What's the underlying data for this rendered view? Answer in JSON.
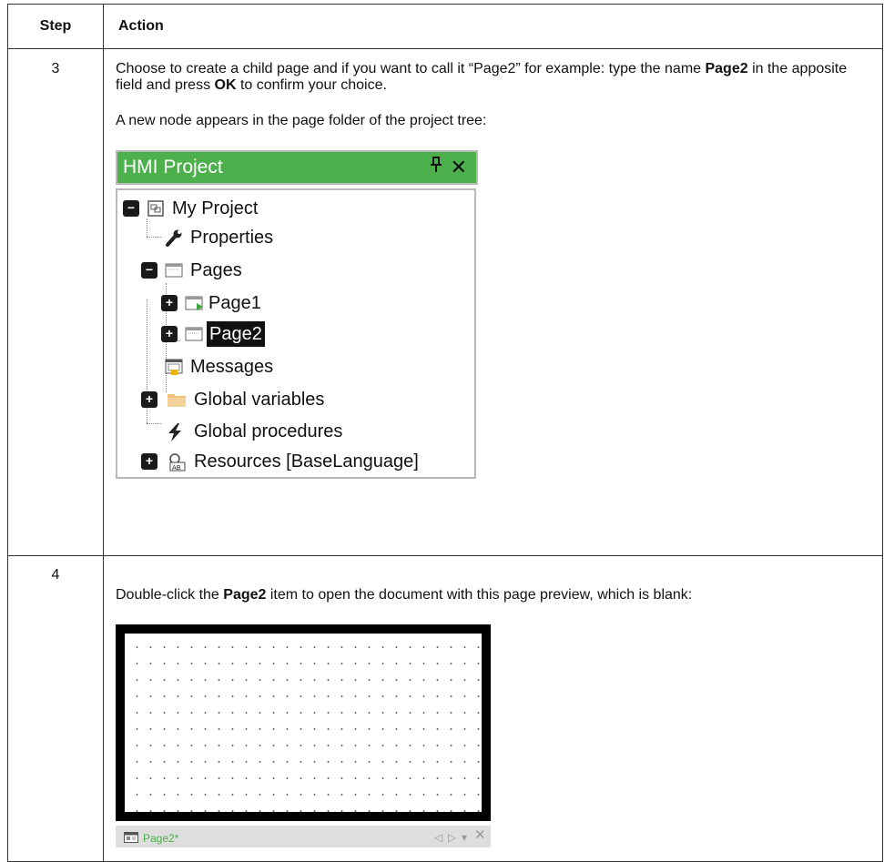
{
  "table": {
    "headers": {
      "step": "Step",
      "action": "Action"
    },
    "rows": [
      {
        "step": "3",
        "para1_pre": "Choose to create a child page and if you want to call it “Page2” for example: type the name ",
        "para1_bold1": "Page2",
        "para1_mid": " in the apposite field and press ",
        "para1_bold2": "OK",
        "para1_post": " to confirm your choice.",
        "para2": "A new node appears in the page folder of the project tree:"
      },
      {
        "step": "4",
        "para_pre": "Double-click the ",
        "para_bold": "Page2",
        "para_post": " item to open the document with this page preview, which is blank:"
      }
    ]
  },
  "hmi_panel": {
    "title": "HMI Project",
    "pin_glyph": "Д",
    "close_glyph": "✕",
    "tree": [
      {
        "label": "My Project",
        "expander": "−",
        "icon": "project-icon"
      },
      {
        "label": "Properties",
        "icon": "wrench-icon"
      },
      {
        "label": "Pages",
        "expander": "−",
        "icon": "pages-icon"
      },
      {
        "label": "Page1",
        "expander": "+",
        "icon": "start-page-icon"
      },
      {
        "label": "Page2",
        "expander": "+",
        "icon": "page-icon",
        "selected": true
      },
      {
        "label": "Messages",
        "icon": "messages-icon"
      },
      {
        "label": "Global variables",
        "expander": "+",
        "icon": "folder-icon"
      },
      {
        "label": "Global procedures",
        "icon": "lightning-icon"
      },
      {
        "label": "Resources [BaseLanguage]",
        "expander": "+",
        "icon": "resources-icon"
      }
    ]
  },
  "preview": {
    "tab_label": "Page2*",
    "controls": {
      "prev": "◁",
      "next": "▷",
      "menu": "▾",
      "close": "✕"
    }
  },
  "colors": {
    "title_bar": "#4cb04c",
    "tab_label": "#4cb04c"
  }
}
